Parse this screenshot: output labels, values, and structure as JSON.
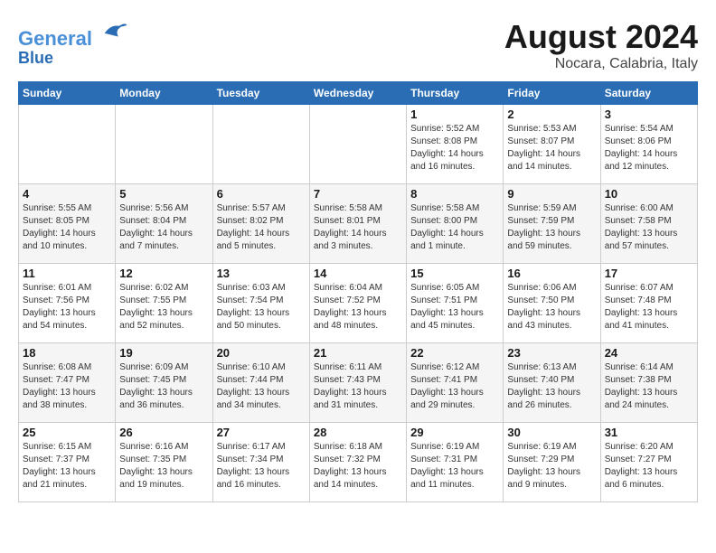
{
  "header": {
    "logo_line1": "General",
    "logo_line2": "Blue",
    "title": "August 2024",
    "subtitle": "Nocara, Calabria, Italy"
  },
  "days_of_week": [
    "Sunday",
    "Monday",
    "Tuesday",
    "Wednesday",
    "Thursday",
    "Friday",
    "Saturday"
  ],
  "weeks": [
    [
      {
        "day": "",
        "info": ""
      },
      {
        "day": "",
        "info": ""
      },
      {
        "day": "",
        "info": ""
      },
      {
        "day": "",
        "info": ""
      },
      {
        "day": "1",
        "info": "Sunrise: 5:52 AM\nSunset: 8:08 PM\nDaylight: 14 hours\nand 16 minutes."
      },
      {
        "day": "2",
        "info": "Sunrise: 5:53 AM\nSunset: 8:07 PM\nDaylight: 14 hours\nand 14 minutes."
      },
      {
        "day": "3",
        "info": "Sunrise: 5:54 AM\nSunset: 8:06 PM\nDaylight: 14 hours\nand 12 minutes."
      }
    ],
    [
      {
        "day": "4",
        "info": "Sunrise: 5:55 AM\nSunset: 8:05 PM\nDaylight: 14 hours\nand 10 minutes."
      },
      {
        "day": "5",
        "info": "Sunrise: 5:56 AM\nSunset: 8:04 PM\nDaylight: 14 hours\nand 7 minutes."
      },
      {
        "day": "6",
        "info": "Sunrise: 5:57 AM\nSunset: 8:02 PM\nDaylight: 14 hours\nand 5 minutes."
      },
      {
        "day": "7",
        "info": "Sunrise: 5:58 AM\nSunset: 8:01 PM\nDaylight: 14 hours\nand 3 minutes."
      },
      {
        "day": "8",
        "info": "Sunrise: 5:58 AM\nSunset: 8:00 PM\nDaylight: 14 hours\nand 1 minute."
      },
      {
        "day": "9",
        "info": "Sunrise: 5:59 AM\nSunset: 7:59 PM\nDaylight: 13 hours\nand 59 minutes."
      },
      {
        "day": "10",
        "info": "Sunrise: 6:00 AM\nSunset: 7:58 PM\nDaylight: 13 hours\nand 57 minutes."
      }
    ],
    [
      {
        "day": "11",
        "info": "Sunrise: 6:01 AM\nSunset: 7:56 PM\nDaylight: 13 hours\nand 54 minutes."
      },
      {
        "day": "12",
        "info": "Sunrise: 6:02 AM\nSunset: 7:55 PM\nDaylight: 13 hours\nand 52 minutes."
      },
      {
        "day": "13",
        "info": "Sunrise: 6:03 AM\nSunset: 7:54 PM\nDaylight: 13 hours\nand 50 minutes."
      },
      {
        "day": "14",
        "info": "Sunrise: 6:04 AM\nSunset: 7:52 PM\nDaylight: 13 hours\nand 48 minutes."
      },
      {
        "day": "15",
        "info": "Sunrise: 6:05 AM\nSunset: 7:51 PM\nDaylight: 13 hours\nand 45 minutes."
      },
      {
        "day": "16",
        "info": "Sunrise: 6:06 AM\nSunset: 7:50 PM\nDaylight: 13 hours\nand 43 minutes."
      },
      {
        "day": "17",
        "info": "Sunrise: 6:07 AM\nSunset: 7:48 PM\nDaylight: 13 hours\nand 41 minutes."
      }
    ],
    [
      {
        "day": "18",
        "info": "Sunrise: 6:08 AM\nSunset: 7:47 PM\nDaylight: 13 hours\nand 38 minutes."
      },
      {
        "day": "19",
        "info": "Sunrise: 6:09 AM\nSunset: 7:45 PM\nDaylight: 13 hours\nand 36 minutes."
      },
      {
        "day": "20",
        "info": "Sunrise: 6:10 AM\nSunset: 7:44 PM\nDaylight: 13 hours\nand 34 minutes."
      },
      {
        "day": "21",
        "info": "Sunrise: 6:11 AM\nSunset: 7:43 PM\nDaylight: 13 hours\nand 31 minutes."
      },
      {
        "day": "22",
        "info": "Sunrise: 6:12 AM\nSunset: 7:41 PM\nDaylight: 13 hours\nand 29 minutes."
      },
      {
        "day": "23",
        "info": "Sunrise: 6:13 AM\nSunset: 7:40 PM\nDaylight: 13 hours\nand 26 minutes."
      },
      {
        "day": "24",
        "info": "Sunrise: 6:14 AM\nSunset: 7:38 PM\nDaylight: 13 hours\nand 24 minutes."
      }
    ],
    [
      {
        "day": "25",
        "info": "Sunrise: 6:15 AM\nSunset: 7:37 PM\nDaylight: 13 hours\nand 21 minutes."
      },
      {
        "day": "26",
        "info": "Sunrise: 6:16 AM\nSunset: 7:35 PM\nDaylight: 13 hours\nand 19 minutes."
      },
      {
        "day": "27",
        "info": "Sunrise: 6:17 AM\nSunset: 7:34 PM\nDaylight: 13 hours\nand 16 minutes."
      },
      {
        "day": "28",
        "info": "Sunrise: 6:18 AM\nSunset: 7:32 PM\nDaylight: 13 hours\nand 14 minutes."
      },
      {
        "day": "29",
        "info": "Sunrise: 6:19 AM\nSunset: 7:31 PM\nDaylight: 13 hours\nand 11 minutes."
      },
      {
        "day": "30",
        "info": "Sunrise: 6:19 AM\nSunset: 7:29 PM\nDaylight: 13 hours\nand 9 minutes."
      },
      {
        "day": "31",
        "info": "Sunrise: 6:20 AM\nSunset: 7:27 PM\nDaylight: 13 hours\nand 6 minutes."
      }
    ]
  ]
}
